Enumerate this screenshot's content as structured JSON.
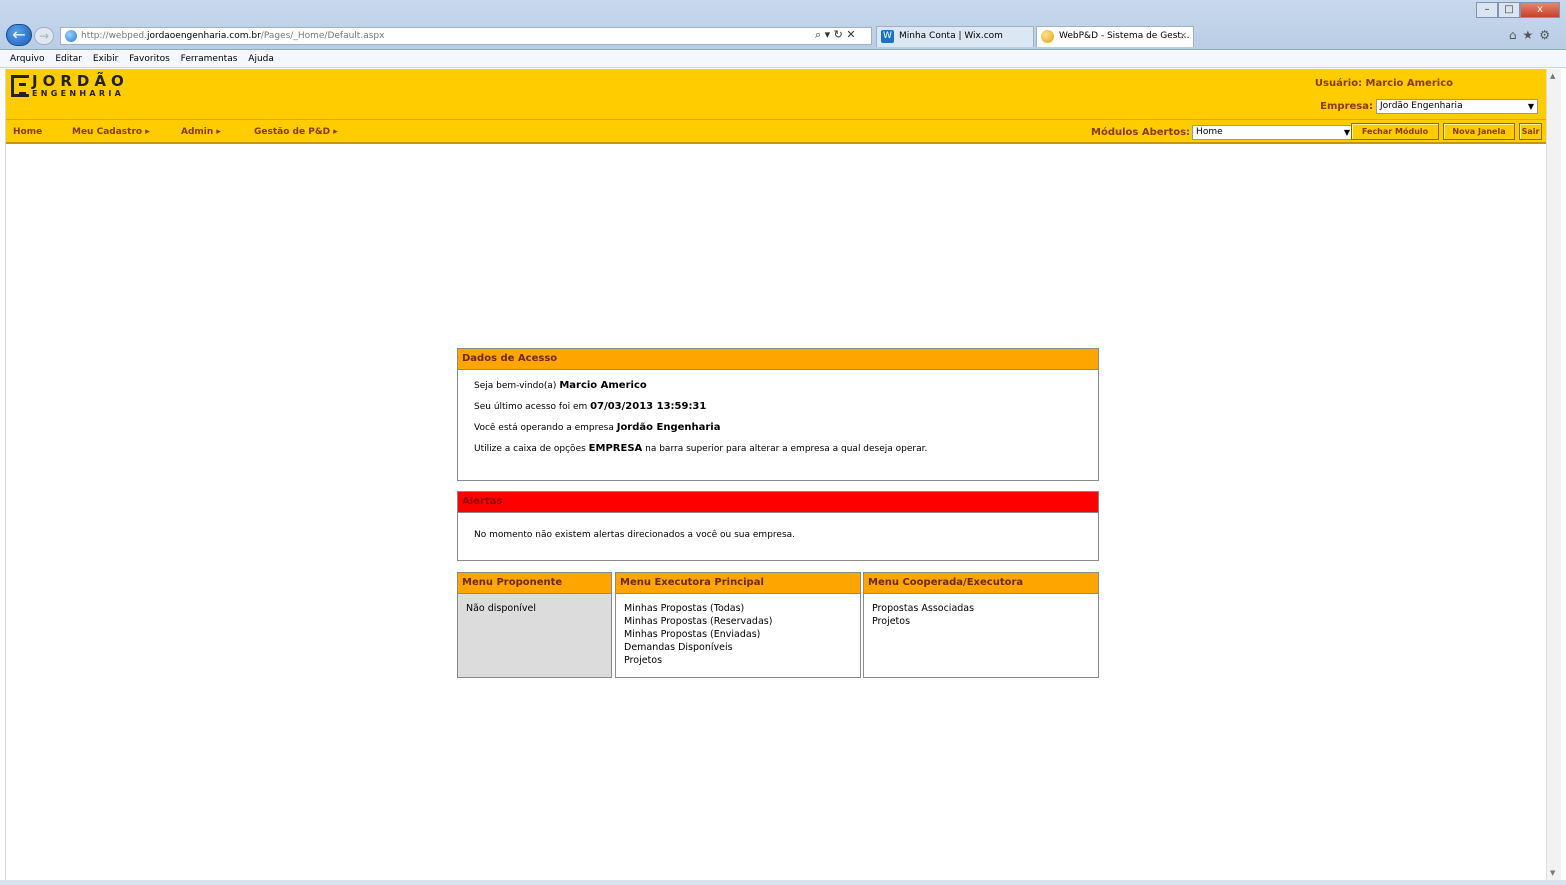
{
  "browser": {
    "address_prefix": "http://webped.",
    "address_domain": "jordaoengenharia.com.br",
    "address_path": "/Pages/_Home/Default.aspx",
    "address_tools": "⌕ ▾ ↻ ✕",
    "tabs": [
      {
        "label": "Minha Conta | Wix.com",
        "icon": "W"
      },
      {
        "label": "WebP&D - Sistema de Gest...",
        "close": "×"
      }
    ],
    "window_buttons": {
      "minimize": "–",
      "maximize": "□",
      "close": "x"
    },
    "top_icons": "⌂★⚙",
    "back": "←",
    "forward": "→"
  },
  "menubar": [
    "Arquivo",
    "Editar",
    "Exibir",
    "Favoritos",
    "Ferramentas",
    "Ajuda"
  ],
  "header": {
    "logo_name": "JORDÃO",
    "logo_sub": "ENGENHARIA",
    "user_label": "Usuário: Marcio Americo",
    "empresa_label": "Empresa:",
    "empresa_value": "Jordão Engenharia"
  },
  "nav": {
    "home": "Home",
    "meu_cadastro": "Meu Cadastro ▸",
    "admin": "Admin ▸",
    "gestao": "Gestão de P&D ▸",
    "modulos_label": "Módulos Abertos:",
    "modulos_value": "Home",
    "fechar_modulo": "Fechar Módulo",
    "nova_janela": "Nova Janela",
    "sair": "Sair"
  },
  "dados_acesso": {
    "title": "Dados de Acesso",
    "welcome_prefix": "Seja bem-vindo(a)",
    "user_name": "Marcio Americo",
    "last_access_prefix": "Seu último acesso foi em",
    "last_access": "07/03/2013 13:59:31",
    "operating_prefix": "Você está operando a empresa",
    "company": "Jordão Engenharia",
    "hint_prefix": "Utilize a caixa de opções",
    "hint_keyword": "EMPRESA",
    "hint_suffix": "na barra superior para alterar a empresa a qual deseja operar."
  },
  "alertas": {
    "title": "Alertas",
    "message": "No momento não existem alertas direcionados a você ou sua empresa."
  },
  "menus": {
    "proponente": {
      "title": "Menu Proponente",
      "items": [
        "Não disponível"
      ]
    },
    "executora": {
      "title": "Menu Executora Principal",
      "items": [
        "Minhas Propostas (Todas)",
        "Minhas Propostas (Reservadas)",
        "Minhas Propostas (Enviadas)",
        "Demandas Disponíveis",
        "Projetos"
      ]
    },
    "cooperada": {
      "title": "Menu Cooperada/Executora",
      "items": [
        "Propostas Associadas",
        "Projetos"
      ]
    }
  },
  "scroll": {
    "up": "▲",
    "down": "▼"
  }
}
